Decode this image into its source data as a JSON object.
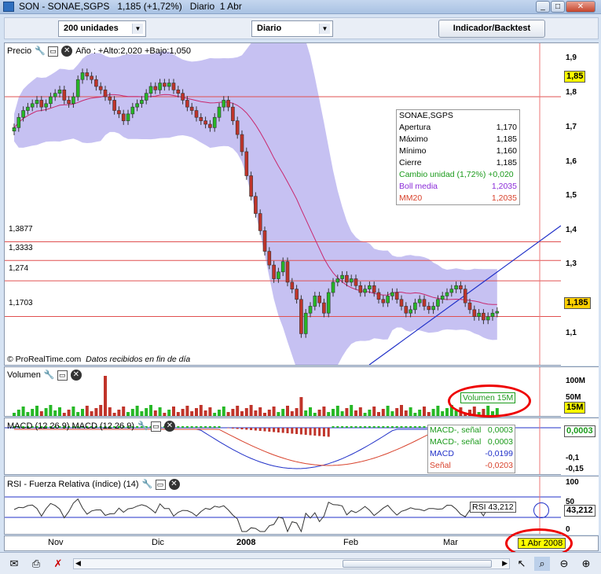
{
  "window": {
    "title": "SON - SONAE,SGPS",
    "price_header": "1,185 (+1,72%)",
    "frequency_header": "Diario",
    "date_header": "1 Abr"
  },
  "toolbar": {
    "units_select": "200 unidades",
    "period_select": "Diario",
    "indicator_button": "Indicador/Backtest"
  },
  "price_panel": {
    "label": "Precio",
    "year_info": "Año : +Alto:2,020 +Bajo:1,050",
    "copyright": "© ProRealTime.com",
    "data_note": "Datos recibidos en fin de día",
    "hlines": [
      "1,3877",
      "1,3333",
      "1,274",
      "1,1703"
    ],
    "y_ticks": [
      "1,9",
      "1,8",
      "1,7",
      "1,6",
      "1,5",
      "1,4",
      "1,3",
      "1,1"
    ],
    "tag_high": "1,85",
    "tag_last": "1,185"
  },
  "ohlc_box": {
    "symbol": "SONAE,SGPS",
    "rows": [
      {
        "label": "Apertura",
        "value": "1,170"
      },
      {
        "label": "Máximo",
        "value": "1,185"
      },
      {
        "label": "Mínimo",
        "value": "1,160"
      },
      {
        "label": "Cierre",
        "value": "1,185"
      }
    ],
    "change": "Cambio unidad (1,72%) +0,020",
    "boll_label": "Boll media",
    "boll_value": "1,2035",
    "mm_label": "MM20",
    "mm_value": "1,2035"
  },
  "volume_panel": {
    "label": "Volumen",
    "callout": "Volumen 15M",
    "y_ticks": [
      "100M",
      "50M"
    ],
    "tag": "15M"
  },
  "macd_panel": {
    "label": "MACD (12 26 9) MACD (12 26 9)",
    "rows": [
      {
        "label": "MACD-, señal",
        "value": "0,0003"
      },
      {
        "label": "MACD-, señal",
        "value": "0,0003"
      },
      {
        "label": "MACD",
        "value": "-0,0199"
      },
      {
        "label": "Señal",
        "value": "-0,0203"
      }
    ],
    "y_ticks": [
      "-0,1",
      "-0,15"
    ],
    "tag": "0,0003"
  },
  "rsi_panel": {
    "label": "RSI - Fuerza Relativa (índice) (14)",
    "callout": "RSI 43,212",
    "y_ticks": [
      "100",
      "50",
      "0"
    ],
    "tag": "43,212"
  },
  "x_axis": {
    "labels": [
      "Nov",
      "Dic",
      "2008",
      "Feb",
      "Mar"
    ],
    "current_date": "1 Abr 2008"
  },
  "colors": {
    "bull": "#26b826",
    "bear": "#c0342a",
    "band": "#c6c1f2",
    "accent_red": "#e00000"
  },
  "chart_data": {
    "type": "candlestick",
    "title": "SONAE,SGPS",
    "ylim": [
      1.05,
      1.92
    ],
    "closes": [
      1.72,
      1.75,
      1.77,
      1.78,
      1.79,
      1.8,
      1.78,
      1.79,
      1.81,
      1.82,
      1.83,
      1.8,
      1.79,
      1.81,
      1.86,
      1.88,
      1.87,
      1.86,
      1.84,
      1.83,
      1.81,
      1.8,
      1.77,
      1.76,
      1.74,
      1.76,
      1.78,
      1.79,
      1.8,
      1.82,
      1.84,
      1.83,
      1.85,
      1.84,
      1.85,
      1.83,
      1.82,
      1.8,
      1.78,
      1.77,
      1.75,
      1.74,
      1.73,
      1.72,
      1.75,
      1.78,
      1.8,
      1.78,
      1.74,
      1.7,
      1.65,
      1.58,
      1.52,
      1.47,
      1.42,
      1.36,
      1.32,
      1.28,
      1.3,
      1.33,
      1.27,
      1.25,
      1.22,
      1.12,
      1.18,
      1.2,
      1.23,
      1.21,
      1.18,
      1.24,
      1.27,
      1.28,
      1.29,
      1.27,
      1.28,
      1.26,
      1.24,
      1.25,
      1.26,
      1.24,
      1.22,
      1.21,
      1.23,
      1.24,
      1.22,
      1.2,
      1.18,
      1.19,
      1.21,
      1.22,
      1.2,
      1.19,
      1.2,
      1.22,
      1.23,
      1.24,
      1.25,
      1.26,
      1.25,
      1.21,
      1.19,
      1.17,
      1.18,
      1.16,
      1.17,
      1.18,
      1.185
    ]
  }
}
